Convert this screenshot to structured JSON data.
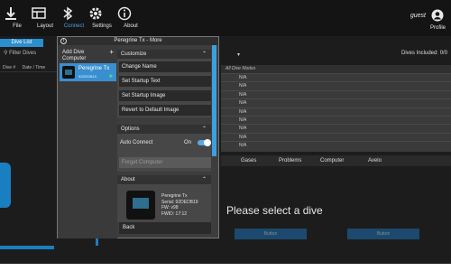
{
  "toolbar": {
    "items": [
      {
        "label": "File",
        "icon": "download-icon"
      },
      {
        "label": "Layout",
        "icon": "layout-icon"
      },
      {
        "label": "Connect",
        "icon": "bluetooth-icon",
        "active": true
      },
      {
        "label": "Settings",
        "icon": "gear-icon"
      },
      {
        "label": "About",
        "icon": "info-icon"
      }
    ],
    "user_name": "guest",
    "profile_label": "Profile"
  },
  "sidebar": {
    "tab_label": "Dive List",
    "filter_label": "Filter Dives",
    "col1": "Dive #",
    "col2": "Date / Time"
  },
  "main": {
    "dives_included": "Dives Included: 0/0",
    "grid_header": "All Dive Modes",
    "grid_rows": [
      "N/A",
      "N/A",
      "N/A",
      "N/A",
      "N/A",
      "N/A",
      "N/A",
      "N/A",
      "N/A"
    ],
    "tabs": [
      "Gases",
      "Problems",
      "Computer",
      "Avelo"
    ],
    "placeholder": "Please select a dive",
    "button_label": "Button"
  },
  "dialog": {
    "title": "Peregrine Tx - More",
    "add_dive_computer": "Add Dive Computer",
    "computer": {
      "name": "Peregrine Tx",
      "serial": "92DEDB19"
    },
    "customize": {
      "header": "Customize",
      "items": [
        "Change Name",
        "Set Startup Text",
        "Set Startup Image",
        "Revert to Default Image"
      ]
    },
    "options": {
      "header": "Options",
      "auto_connect_label": "Auto Connect",
      "auto_connect_state": "On",
      "auto_connect_enabled": true,
      "forget_label": "Forget Computer"
    },
    "about": {
      "header": "About",
      "lines": [
        "Peregrine Tx",
        "Serial: 92DEDB19",
        "FW: v98",
        "FWID: 17:12"
      ]
    },
    "back_label": "Back"
  },
  "colors": {
    "accent": "#3a8fd1",
    "background": "#1c1c1c"
  }
}
